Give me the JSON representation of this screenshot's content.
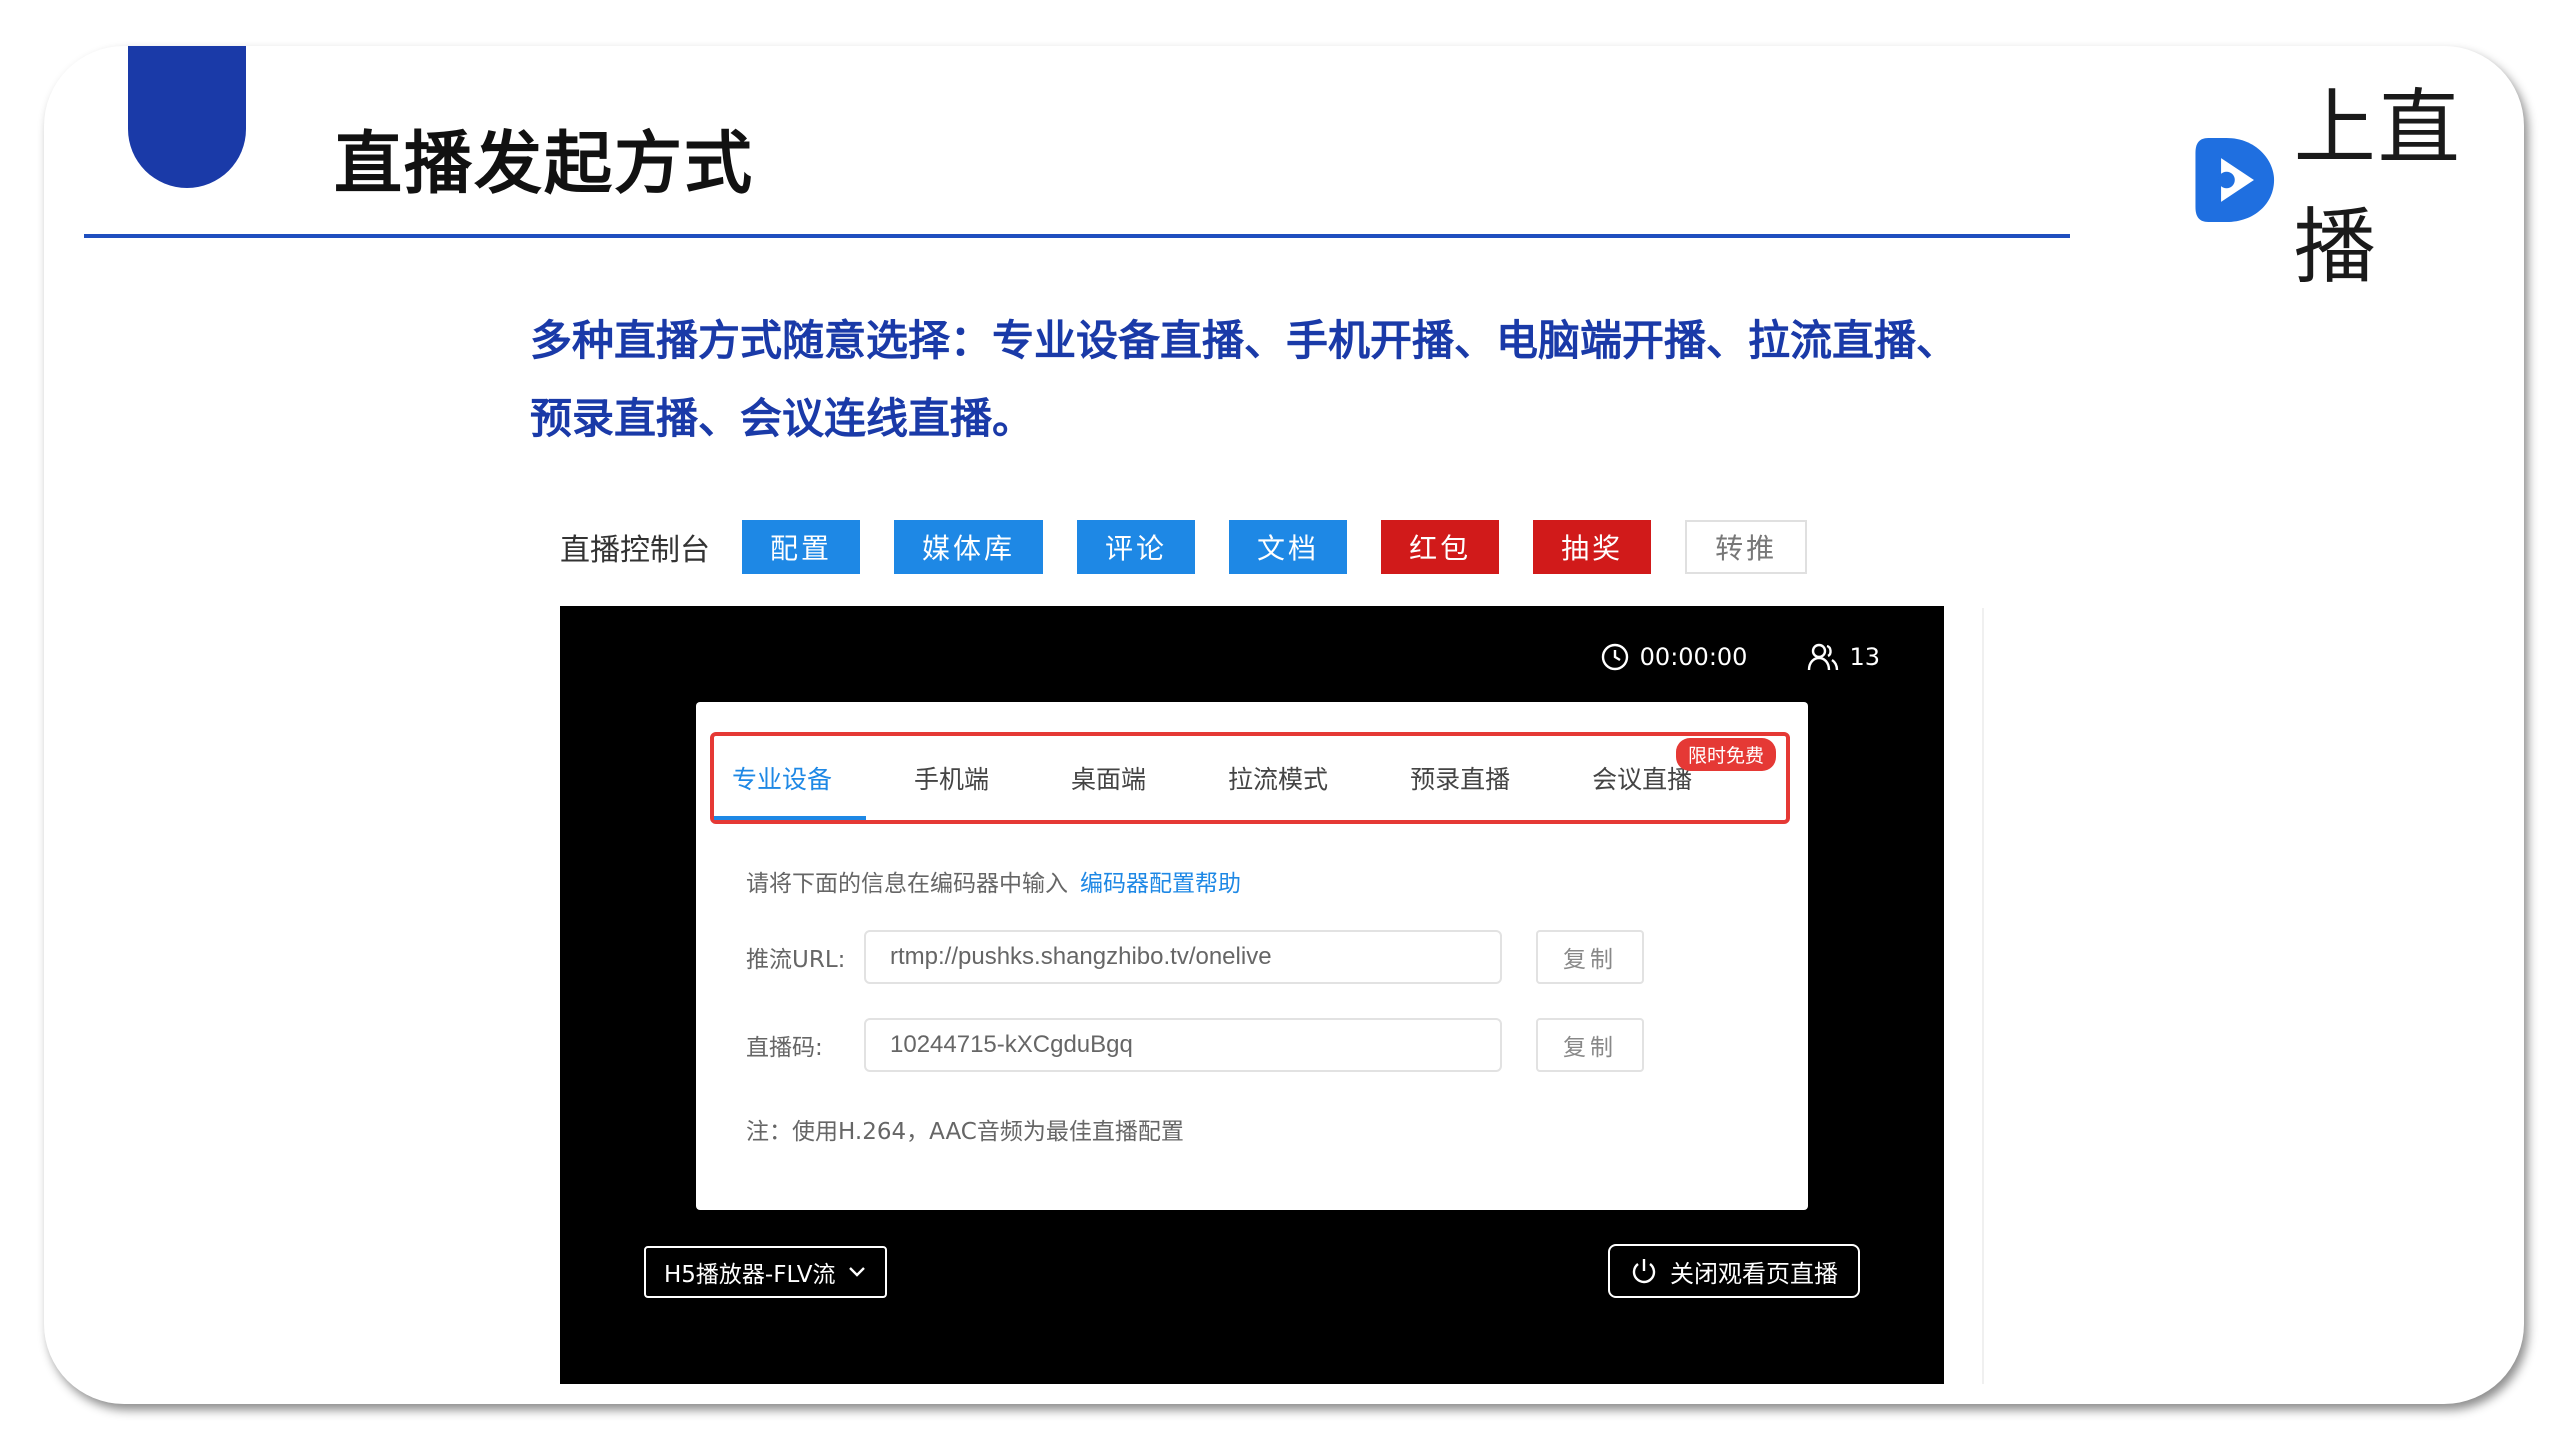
{
  "slide": {
    "title": "直播发起方式",
    "logo_text": "上直播",
    "intro_line1": "多种直播方式随意选择：专业设备直播、手机开播、电脑端开播、拉流直播、",
    "intro_line2": "预录直播、会议连线直播。"
  },
  "toolbar": {
    "label": "直播控制台",
    "buttons": [
      {
        "label": "配置"
      },
      {
        "label": "媒体库"
      },
      {
        "label": "评论"
      },
      {
        "label": "文档"
      },
      {
        "label": "红包"
      },
      {
        "label": "抽奖"
      },
      {
        "label": "转推"
      }
    ]
  },
  "stage": {
    "timer": "00:00:00",
    "viewers": "13",
    "player_select": "H5播放器-FLV流",
    "close_button": "关闭观看页直播"
  },
  "panel": {
    "tabs": [
      {
        "label": "专业设备"
      },
      {
        "label": "手机端"
      },
      {
        "label": "桌面端"
      },
      {
        "label": "拉流模式"
      },
      {
        "label": "预录直播"
      },
      {
        "label": "会议直播"
      }
    ],
    "badge": "限时免费",
    "hint": "请将下面的信息在编码器中输入",
    "help_link": "编码器配置帮助",
    "push_url_label": "推流URL:",
    "push_url_value": "rtmp://pushks.shangzhibo.tv/onelive",
    "stream_key_label": "直播码:",
    "stream_key_value": "10244715-kXCgduBgq",
    "copy_label": "复制",
    "note": "注：使用H.264，AAC音频为最佳直播配置"
  },
  "colors": {
    "brand_blue": "#1a3aa8",
    "accent_blue": "#1e88e5",
    "red": "#d11a1a"
  }
}
